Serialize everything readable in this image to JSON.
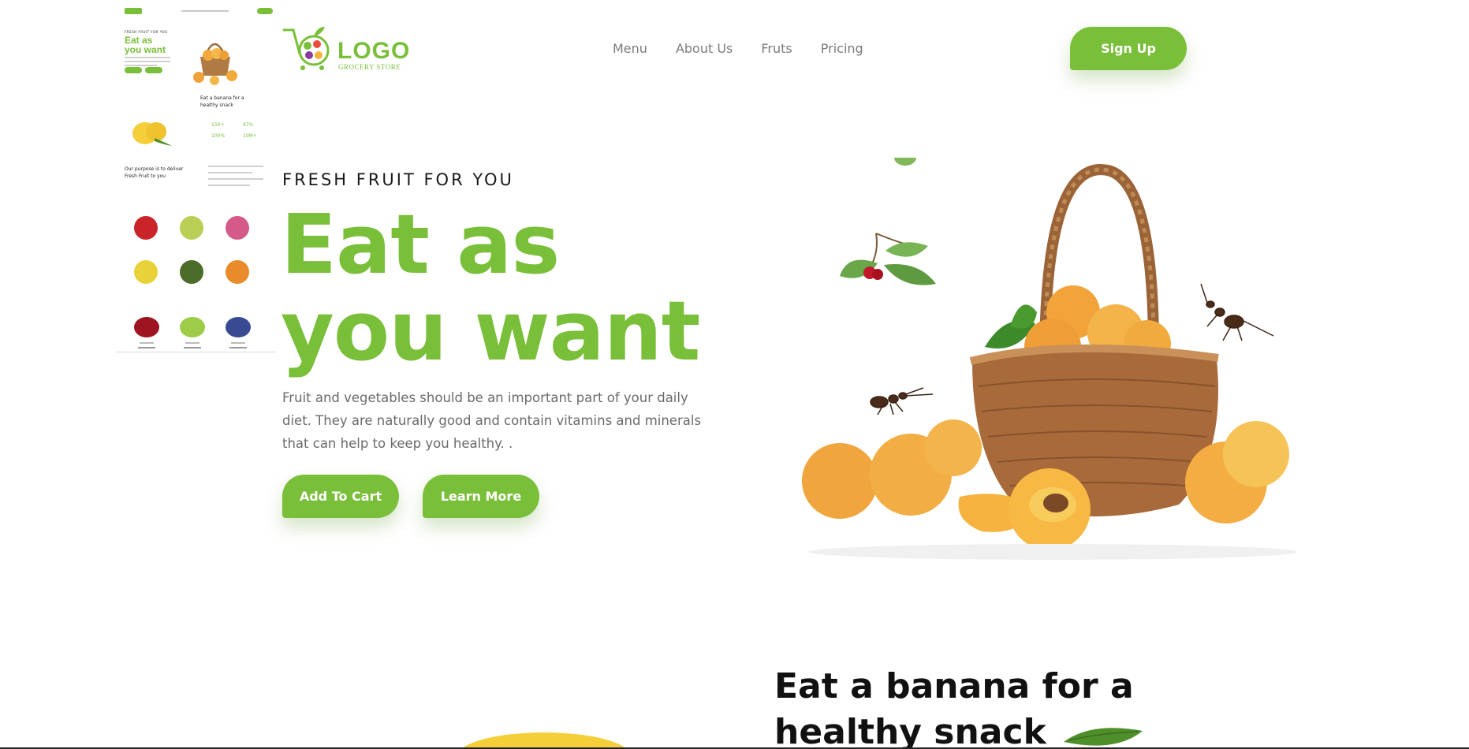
{
  "header": {
    "logo_text": "LOGO",
    "logo_subtext": "GROCERY STORE",
    "nav": [
      "Menu",
      "About Us",
      "Fruts",
      "Pricing"
    ],
    "signup_label": "Sign Up"
  },
  "hero": {
    "kicker": "FRESH FRUIT FOR YOU",
    "title_line1": "Eat as",
    "title_line2": "you want",
    "description": "Fruit and vegetables should be an important part of your daily diet. They are naturally good and contain vitamins and minerals that can help to keep you healthy. .",
    "add_to_cart_label": "Add To Cart",
    "learn_more_label": "Learn More"
  },
  "section2": {
    "title_line1": "Eat a banana for a",
    "title_line2": "healthy snack"
  },
  "thumbnail": {
    "kicker": "FRESH FRUIT FOR YOU",
    "title_line1": "Eat as",
    "title_line2": "you want",
    "snack_line1": "Eat a banana for a",
    "snack_line2": "healthy snack",
    "stat1": "150+",
    "stat2": "97%",
    "stat3": "100%",
    "stat4": "10M+",
    "purpose_line1": "Our purpose is to deliver",
    "purpose_line2": "Fresh Fruit to you"
  },
  "colors": {
    "accent": "#7abf3a",
    "text_dark": "#1c1c1c",
    "text_muted": "#6a6a6a"
  }
}
